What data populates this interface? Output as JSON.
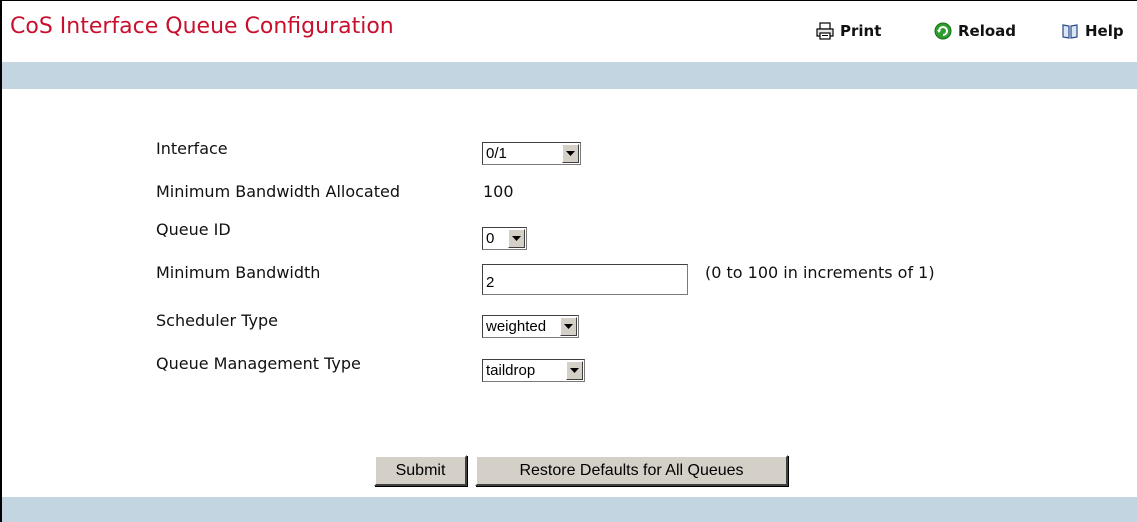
{
  "header": {
    "title": "CoS Interface Queue Configuration",
    "print_label": "Print",
    "reload_label": "Reload",
    "help_label": "Help",
    "title_color": "#c8102e",
    "band_color": "#c2d5e1"
  },
  "form": {
    "interface_label": "Interface",
    "interface_value": "0/1",
    "min_bw_allocated_label": "Minimum Bandwidth Allocated",
    "min_bw_allocated_value": "100",
    "queue_id_label": "Queue ID",
    "queue_id_value": "0",
    "min_bw_label": "Minimum Bandwidth",
    "min_bw_value": "2",
    "min_bw_hint": "(0 to 100 in increments of 1)",
    "scheduler_label": "Scheduler Type",
    "scheduler_value": "weighted",
    "queue_mgmt_label": "Queue Management Type",
    "queue_mgmt_value": "taildrop"
  },
  "buttons": {
    "submit_label": "Submit",
    "restore_label": "Restore Defaults for All Queues"
  }
}
